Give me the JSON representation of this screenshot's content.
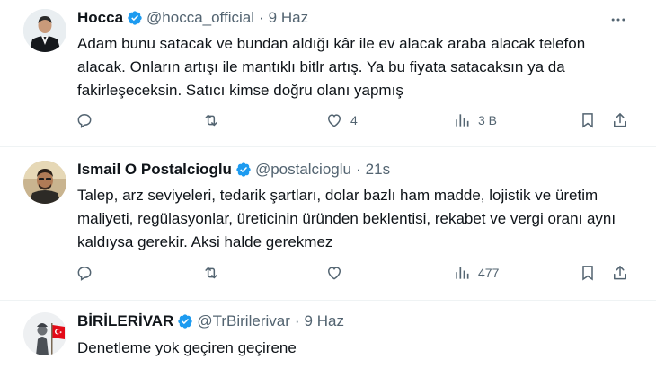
{
  "tweets": [
    {
      "name": "Hocca",
      "handle": "@hocca_official",
      "separator": "·",
      "time": "9 Haz",
      "text": "Adam bunu satacak ve bundan aldığı kâr ile ev alacak araba alacak telefon alacak. Onların artışı ile mantıklı bitlr artış. Ya bu fiyata satacaksın ya da fakirleşeceksin. Satıcı kimse doğru olanı yapmış",
      "likes": "4",
      "views": "3 B",
      "avatar_icon": "user-avatar-suit"
    },
    {
      "name": "Ismail O Postalcioglu",
      "handle": "@postalcioglu",
      "separator": "·",
      "time": "21s",
      "text": "Talep, arz seviyeleri, tedarik şartları, dolar bazlı ham madde, lojistik ve üretim maliyeti, regülasyonlar, üreticinin üründen beklentisi, rekabet ve vergi oranı aynı kaldıysa gerekir. Aksi halde gerekmez",
      "views": "477",
      "avatar_icon": "user-avatar-portrait"
    },
    {
      "name": "BİRİLERİVAR",
      "handle": "@TrBirilerivar",
      "separator": "·",
      "time": "9 Haz",
      "text": "Denetleme yok geçiren geçirene",
      "avatar_icon": "user-avatar-statue-flag"
    }
  ],
  "colors": {
    "verified": "#1d9bf0",
    "icon": "#536471",
    "text": "#0f1419",
    "divider": "#eff3f4"
  },
  "icons": {
    "more": "more-dots-icon",
    "reply": "reply-icon",
    "retweet": "retweet-icon",
    "like": "heart-icon",
    "views": "views-chart-icon",
    "bookmark": "bookmark-icon",
    "share": "share-icon",
    "verified": "verified-badge-icon"
  }
}
